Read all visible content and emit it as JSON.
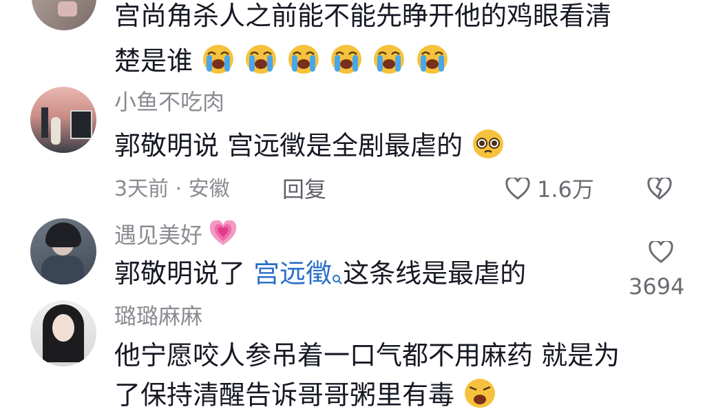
{
  "comments": [
    {
      "text_line1": "宫尚角杀人之前能不能先睁开他的鸡眼看清",
      "text_line2": "楚是谁"
    },
    {
      "username": "小鱼不吃肉",
      "text": "郭敬明说 宫远徵是全剧最虐的",
      "meta": "3天前 · 安徽",
      "reply_label": "回复",
      "like_count": "1.6万"
    },
    {
      "username": "遇见美好",
      "text_prefix": "郭敬明说了 ",
      "link_text": "宫远徵",
      "text_suffix": "这条线是最虐的",
      "like_count": "3694"
    },
    {
      "username": "璐璐麻麻",
      "text_line1": "他宁愿咬人参吊着一口气都不用麻药  就是为",
      "text_line2": "了保持清醒告诉哥哥粥里有毒"
    }
  ],
  "icons": {
    "emoji_crying": "loudly-crying-face",
    "emoji_pleading": "pleading-face",
    "emoji_heart": "growing-heart",
    "like": "heart-outline-icon",
    "dislike": "broken-heart-icon",
    "link_search": "search-icon"
  },
  "colors": {
    "text": "#161823",
    "secondary": "#8a8b91",
    "link": "#2a6fc9"
  }
}
